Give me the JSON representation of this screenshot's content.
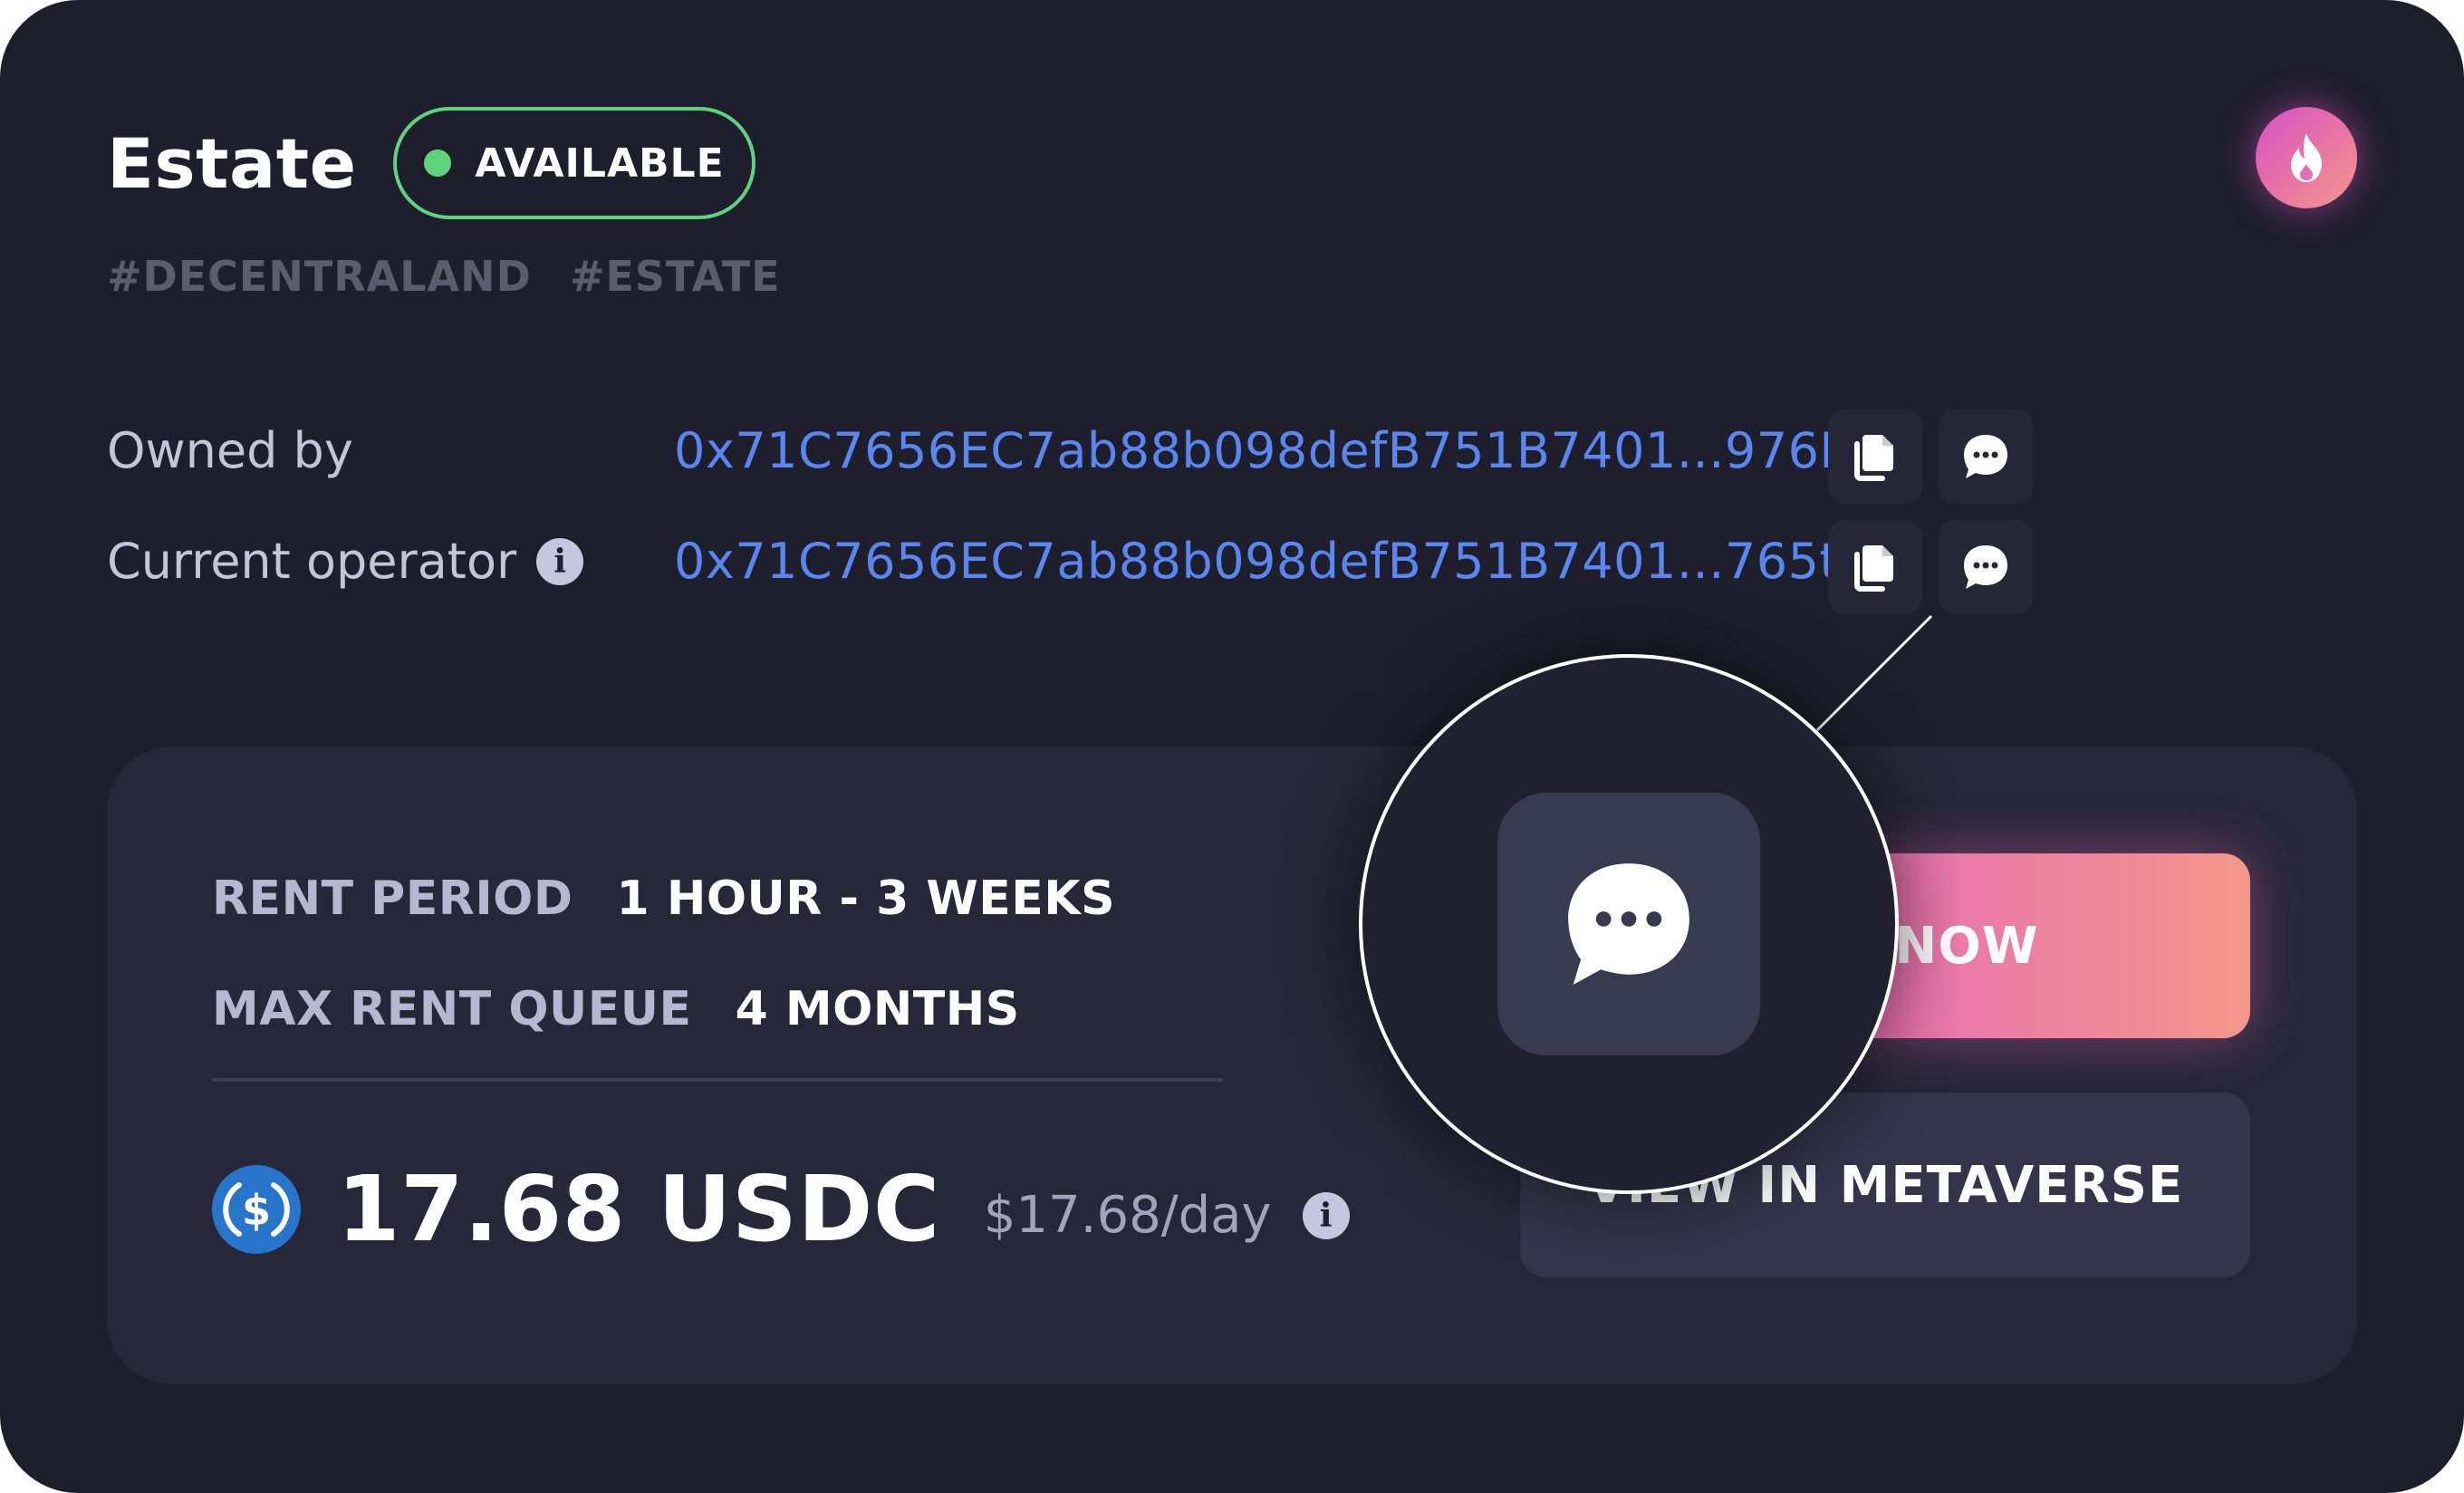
{
  "estate": {
    "title": "Estate",
    "status": "AVAILABLE",
    "tags": [
      "#DECENTRALAND",
      "#ESTATE"
    ]
  },
  "ownership": {
    "owned_by_label": "Owned by",
    "owned_by_address": "0x71C7656EC7ab88b098defB751B7401...976F",
    "operator_label": "Current operator",
    "operator_address": "0x71C7656EC7ab88b098defB751B7401...765t"
  },
  "rent": {
    "period_label": "RENT PERIOD",
    "period_value": "1 HOUR - 3 WEEKS",
    "queue_label": "MAX RENT QUEUE",
    "queue_value": "4 MONTHS",
    "price": "17.68 USDC",
    "price_per_day": "$17.68/day",
    "currency_icon": "usdc-coin-icon"
  },
  "actions": {
    "rent_now_visible": "NOW",
    "view_metaverse_visible": "VIEW IN METAVERSE"
  },
  "colors": {
    "background": "#1e1e2c",
    "panel": "#262738",
    "available_green": "#5fd37d",
    "address_blue": "#5a86f0",
    "gradient_start": "#d94fc6",
    "gradient_end": "#f3978a"
  }
}
